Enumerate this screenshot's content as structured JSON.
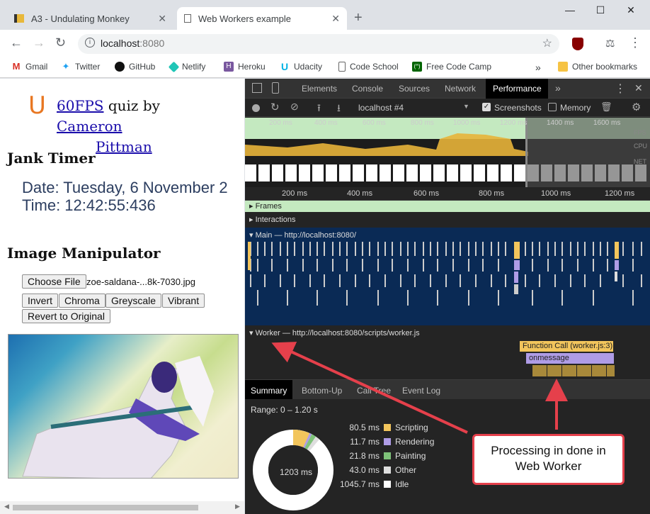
{
  "browser": {
    "tabs": [
      {
        "title": "A3 - Undulating Monkey",
        "active": false
      },
      {
        "title": "Web Workers example",
        "active": true
      }
    ],
    "url_host": "localhost",
    "url_port": ":8080",
    "bookmarks": [
      "Gmail",
      "Twitter",
      "GitHub",
      "Netlify",
      "Heroku",
      "Udacity",
      "Code School",
      "Free Code Camp"
    ],
    "more": "»",
    "other_bookmarks": "Other bookmarks"
  },
  "page": {
    "logo": "U",
    "quiz_link": "60FPS",
    "quiz_by": " quiz by ",
    "author_first": "Cameron",
    "author_last": "Pittman",
    "jank_heading": "Jank Timer",
    "date_line": "Date: Tuesday, 6 November 2",
    "time_line": "Time: 12:42:55:436",
    "image_heading": "Image Manipulator",
    "choose_file": "Choose File",
    "file_name": "zoe-saldana-...8k-7030.jpg",
    "buttons": [
      "Invert",
      "Chroma",
      "Greyscale",
      "Vibrant"
    ],
    "revert": "Revert to Original"
  },
  "devtools": {
    "tabs": [
      "Elements",
      "Console",
      "Sources",
      "Network",
      "Performance"
    ],
    "more": "»",
    "profile_select": "localhost #4",
    "screenshots_label": "Screenshots",
    "memory_label": "Memory",
    "overview_ticks": [
      "200 ms",
      "400 ms",
      "600 ms",
      "800 ms",
      "1000 ms",
      "1200 ms",
      "1400 ms",
      "1600 ms"
    ],
    "overview_lanes": [
      "FPS",
      "CPU",
      "NET"
    ],
    "ruler_ticks": [
      "200 ms",
      "400 ms",
      "600 ms",
      "800 ms",
      "1000 ms",
      "1200 ms"
    ],
    "frames_label": "Frames",
    "interactions_label": "Interactions",
    "main_label": "Main — http://localhost:8080/",
    "worker_label": "Worker — http://localhost:8080/scripts/worker.js",
    "function_call": "Function Call (worker.js:3)",
    "onmessage": "onmessage",
    "bottom_tabs": [
      "Summary",
      "Bottom-Up",
      "Call Tree",
      "Event Log"
    ],
    "range": "Range: 0 – 1.20 s",
    "total": "1203 ms",
    "summary": [
      {
        "value": "80.5 ms",
        "label": "Scripting",
        "color": "#f2c55c"
      },
      {
        "value": "11.7 ms",
        "label": "Rendering",
        "color": "#af9ce6"
      },
      {
        "value": "21.8 ms",
        "label": "Painting",
        "color": "#7ec279"
      },
      {
        "value": "43.0 ms",
        "label": "Other",
        "color": "#dedede"
      },
      {
        "value": "1045.7 ms",
        "label": "Idle",
        "color": "#ffffff"
      }
    ]
  },
  "callout": {
    "line1": "Processing in done in",
    "line2": "Web Worker"
  }
}
